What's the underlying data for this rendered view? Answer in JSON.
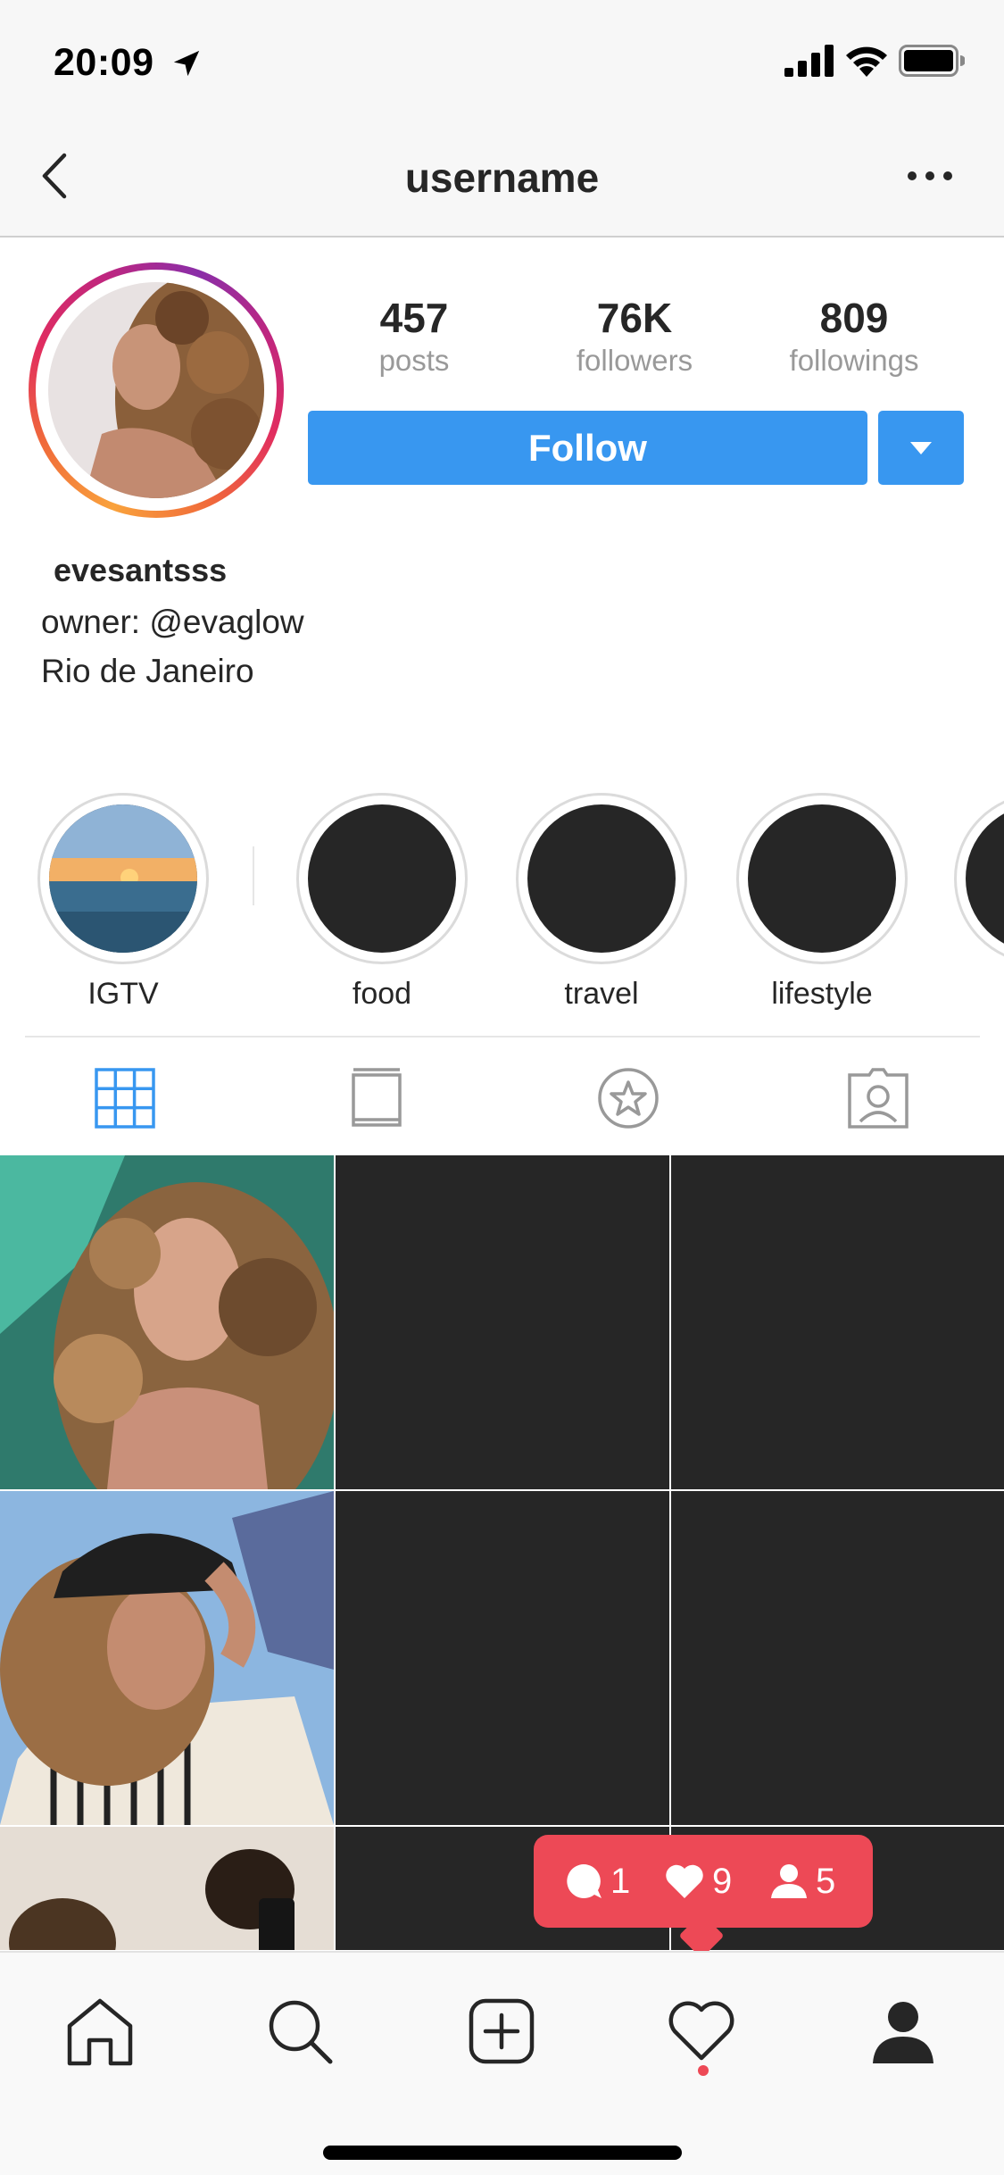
{
  "status_bar": {
    "time": "20:09"
  },
  "nav": {
    "title": "username"
  },
  "profile": {
    "stats": [
      {
        "value": "457",
        "label": "posts"
      },
      {
        "value": "76K",
        "label": "followers"
      },
      {
        "value": "809",
        "label": "followings"
      }
    ],
    "follow_label": "Follow",
    "name": "evesantsss",
    "bio": [
      "owner: @evaglow",
      "Rio de Janeiro"
    ]
  },
  "highlights": [
    {
      "label": "IGTV"
    },
    {
      "label": "food"
    },
    {
      "label": "travel"
    },
    {
      "label": "lifestyle"
    }
  ],
  "tabs": [
    "grid-icon",
    "igtv-icon",
    "saved-icon",
    "tagged-icon"
  ],
  "notification": {
    "comments": "1",
    "likes": "9",
    "follows": "5"
  },
  "tab_bar": [
    "home-icon",
    "search-icon",
    "add-post-icon",
    "activity-icon",
    "profile-icon"
  ],
  "colors": {
    "accent": "#3897f0",
    "notification": "#ed4956",
    "placeholder": "#262626"
  }
}
